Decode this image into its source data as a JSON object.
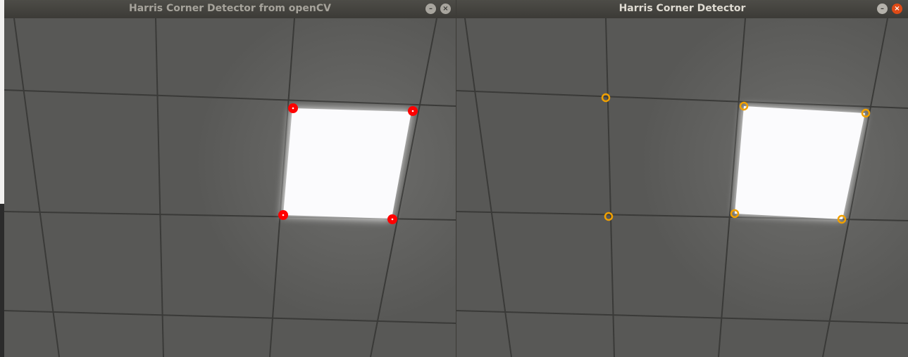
{
  "windows": [
    {
      "title": "Harris Corner Detector from openCV",
      "minimize_icon": "minimize-icon",
      "close_icon": "close-icon"
    },
    {
      "title": "Harris Corner Detector",
      "minimize_icon": "minimize-icon",
      "close_icon": "close-icon"
    }
  ],
  "glyphs": {
    "minimize": "–",
    "close": "×"
  },
  "colors": {
    "opencv_marker": "#ff0000",
    "custom_marker": "#ffa500",
    "titlebar": "#3c3b37",
    "close_active": "#df4a16"
  }
}
